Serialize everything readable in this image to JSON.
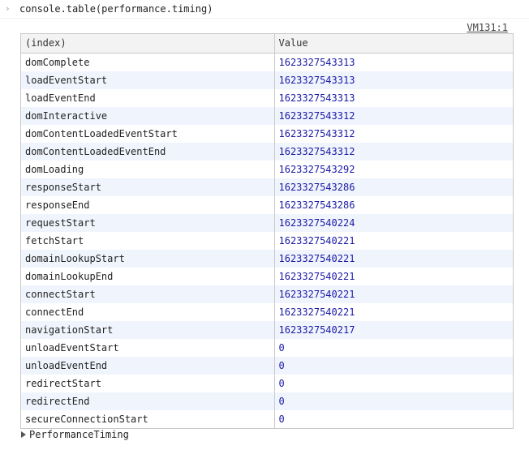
{
  "console": {
    "command": "console.table(performance.timing)",
    "prompt_icon": "chevron-right-icon",
    "source_link": "VM131:1"
  },
  "table": {
    "headers": [
      "(index)",
      "Value"
    ],
    "rows": [
      {
        "index": "domComplete",
        "value": "1623327543313"
      },
      {
        "index": "loadEventStart",
        "value": "1623327543313"
      },
      {
        "index": "loadEventEnd",
        "value": "1623327543313"
      },
      {
        "index": "domInteractive",
        "value": "1623327543312"
      },
      {
        "index": "domContentLoadedEventStart",
        "value": "1623327543312"
      },
      {
        "index": "domContentLoadedEventEnd",
        "value": "1623327543312"
      },
      {
        "index": "domLoading",
        "value": "1623327543292"
      },
      {
        "index": "responseStart",
        "value": "1623327543286"
      },
      {
        "index": "responseEnd",
        "value": "1623327543286"
      },
      {
        "index": "requestStart",
        "value": "1623327540224"
      },
      {
        "index": "fetchStart",
        "value": "1623327540221"
      },
      {
        "index": "domainLookupStart",
        "value": "1623327540221"
      },
      {
        "index": "domainLookupEnd",
        "value": "1623327540221"
      },
      {
        "index": "connectStart",
        "value": "1623327540221"
      },
      {
        "index": "connectEnd",
        "value": "1623327540221"
      },
      {
        "index": "navigationStart",
        "value": "1623327540217"
      },
      {
        "index": "unloadEventStart",
        "value": "0"
      },
      {
        "index": "unloadEventEnd",
        "value": "0"
      },
      {
        "index": "redirectStart",
        "value": "0"
      },
      {
        "index": "redirectEnd",
        "value": "0"
      },
      {
        "index": "secureConnectionStart",
        "value": "0"
      }
    ]
  },
  "footer": {
    "object_label": "PerformanceTiming",
    "expand_icon": "triangle-right-icon"
  },
  "colors": {
    "value_text": "#1a1aa6",
    "stripe": "#f0f5fd",
    "header_bg": "#f3f3f3",
    "border": "#c8c8c8"
  }
}
